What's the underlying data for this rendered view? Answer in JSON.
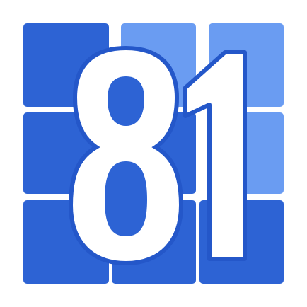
{
  "logo": {
    "numeral": "81",
    "colors": {
      "background": "#ffffff",
      "tile_dark": "#2d63d4",
      "tile_light": "#6a9cf2",
      "numeral_fill": "#ffffff",
      "numeral_outline": "#2457c9"
    },
    "grid": {
      "rows": 3,
      "columns": 3,
      "tile_shades": [
        [
          "dark",
          "light",
          "light"
        ],
        [
          "dark",
          "dark",
          "light"
        ],
        [
          "dark",
          "dark",
          "dark"
        ]
      ]
    }
  }
}
